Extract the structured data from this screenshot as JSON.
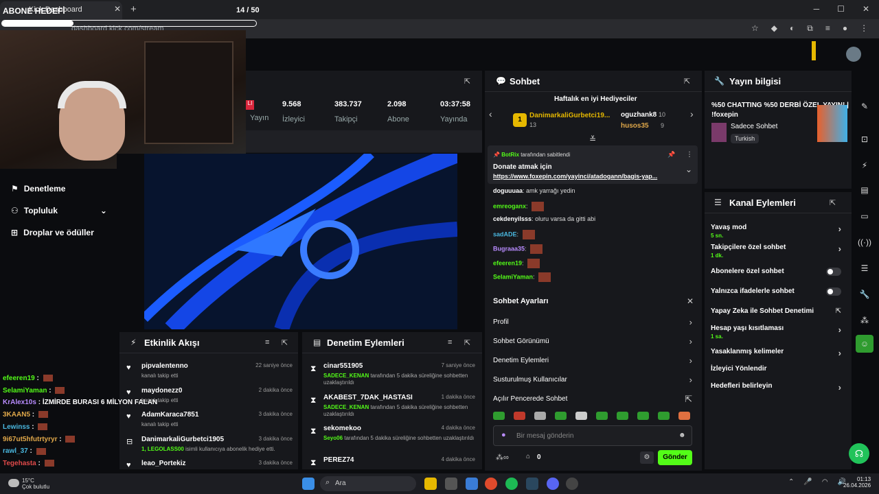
{
  "browser": {
    "tab_title": "Kick Dashboard",
    "url": "dashboard.kick.com/stream"
  },
  "overlay": {
    "goal_label": "ABONE HEDEFİ",
    "goal_count": "14 / 50",
    "goal_progress": 0.28
  },
  "stats": [
    {
      "value": "",
      "label": "Yayın"
    },
    {
      "value": "9.568",
      "label": "İzleyici"
    },
    {
      "value": "383.737",
      "label": "Takipçi"
    },
    {
      "value": "2.098",
      "label": "Abone"
    },
    {
      "value": "03:37:58",
      "label": "Yayında"
    }
  ],
  "leftnav": [
    {
      "label": "Denetleme"
    },
    {
      "label": "Topluluk"
    },
    {
      "label": "Droplar ve ödüller"
    }
  ],
  "overlay_chat": [
    {
      "user": "efeeren19",
      "color": "#53fc18",
      "text": ""
    },
    {
      "user": "SelamiYaman",
      "color": "#53fc18",
      "text": ""
    },
    {
      "user": "KrAlex10s",
      "color": "#b98cff",
      "text": "İZMİRDE BURASI 6 MİLYON FALAN"
    },
    {
      "user": "3KAAN5",
      "color": "#e0a84a",
      "text": ""
    },
    {
      "user": "Lewinss",
      "color": "#4ab8e0",
      "text": ""
    },
    {
      "user": "9i67ut5hfutrtyryr",
      "color": "#e0a84a",
      "text": ""
    },
    {
      "user": "rawl_37",
      "color": "#4ab8e0",
      "text": ""
    },
    {
      "user": "Tegehasta",
      "color": "#e04a4a",
      "text": ""
    }
  ],
  "activity": {
    "title": "Etkinlik Akışı",
    "items": [
      {
        "name": "pipvalentenno",
        "time": "22 saniye önce",
        "sub": "kanalı takip etti"
      },
      {
        "name": "maydonezz0",
        "time": "2 dakika önce",
        "sub": "kanalı takip etti"
      },
      {
        "name": "AdamKaraca7851",
        "time": "3 dakika önce",
        "sub": "kanalı takip etti"
      },
      {
        "name": "DanimarkaliGurbetci1905",
        "time": "3 dakika önce",
        "sub_hl": "1, LEGOLASS00",
        "sub": " isimli kullanıcıya abonelik hediye etti."
      },
      {
        "name": "leao_Portekiz",
        "time": "3 dakika önce",
        "sub": ""
      }
    ]
  },
  "mod": {
    "title": "Denetim Eylemleri",
    "items": [
      {
        "name": "cinar551905",
        "time": "7 saniye önce",
        "mod": "SADECE_KENAN",
        "sub": " tarafından 5 dakika süreliğine sohbetten uzaklaştırıldı"
      },
      {
        "name": "AKABEST_7DAK_HASTASI",
        "time": "1 dakika önce",
        "mod": "SADECE_KENAN",
        "sub": " tarafından 5 dakika süreliğine sohbetten uzaklaştırıldı"
      },
      {
        "name": "sekomekoo",
        "time": "4 dakika önce",
        "mod": "Seyo06",
        "sub": " tarafından 5 dakika süreliğine sohbetten uzaklaştırıldı"
      },
      {
        "name": "PEREZ74",
        "time": "4 dakika önce",
        "mod": "",
        "sub": ""
      }
    ]
  },
  "chat": {
    "title": "Sohbet",
    "gifters_title": "Haftalık en iyi Hediyeciler",
    "gifter1": {
      "rank": "1",
      "name": "DanimarkaliGurbetci19...",
      "count": "13"
    },
    "gifter2": {
      "name": "oguzhank8",
      "count": "10"
    },
    "gifter3": {
      "name": "husos35",
      "count": "9"
    },
    "pinned": {
      "by": "BotRix",
      "by_suffix": "tarafından sabitlendi",
      "title": "Donate atmak için",
      "link": "https://www.foxepin.com/yayinci/atadogann/bagis-yap..."
    },
    "messages": [
      {
        "user": "doguuuaa",
        "color": "#ffffff",
        "text": "amk yarrağı yedin"
      },
      {
        "user": "emreoganx",
        "color": "#53fc18",
        "text": ""
      },
      {
        "user": "cekdenyilsss",
        "color": "#ffffff",
        "text": "oluru varsa da gitti abi"
      },
      {
        "user": "sadADE",
        "color": "#4ab8e0",
        "text": ""
      },
      {
        "user": "Bugraaa35",
        "color": "#b98cff",
        "text": ""
      },
      {
        "user": "efeeren19",
        "color": "#53fc18",
        "text": ""
      },
      {
        "user": "SelamiYaman",
        "color": "#53fc18",
        "text": ""
      }
    ],
    "settings_title": "Sohbet Ayarları",
    "settings": [
      {
        "label": "Profil"
      },
      {
        "label": "Sohbet Görünümü"
      },
      {
        "label": "Denetim Eylemleri"
      },
      {
        "label": "Susturulmuş Kullanıcılar"
      },
      {
        "label": "Açılır Pencerede Sohbet"
      }
    ],
    "input_placeholder": "Bir mesaj gönderin",
    "points": "0",
    "send": "Gönder"
  },
  "info": {
    "title": "Yayın bilgisi",
    "stream_title": "%50 CHATTING %50 DERBİ ÖZEL YAYIN! | !foxepin",
    "category": "Sadece Sohbet",
    "language": "Turkish"
  },
  "channel": {
    "title": "Kanal Eylemleri",
    "rows": [
      {
        "label": "Yavaş mod",
        "sub": "5 sn.",
        "kind": "arrow"
      },
      {
        "label": "Takipçilere özel sohbet",
        "sub": "1 dk.",
        "kind": "arrow"
      },
      {
        "label": "Abonelere özel sohbet",
        "sub": "",
        "kind": "toggle"
      },
      {
        "label": "Yalnızca ifadelerle sohbet",
        "sub": "",
        "kind": "toggle"
      },
      {
        "label": "Yapay Zeka ile Sohbet Denetimi",
        "sub": "",
        "kind": "external"
      },
      {
        "label": "Hesap yaşı kısıtlaması",
        "sub": "1 sa.",
        "kind": "arrow"
      },
      {
        "label": "Yasaklanmış kelimeler",
        "sub": "",
        "kind": "arrow"
      },
      {
        "label": "İzleyici Yönlendir",
        "sub": "",
        "kind": "none"
      },
      {
        "label": "Hedefleri belirleyin",
        "sub": "",
        "kind": "arrow"
      }
    ]
  },
  "taskbar": {
    "search": "Ara",
    "temp": "15°C",
    "weather": "Çok bulutlu",
    "time": "01:13",
    "date": "26.04.2026"
  }
}
